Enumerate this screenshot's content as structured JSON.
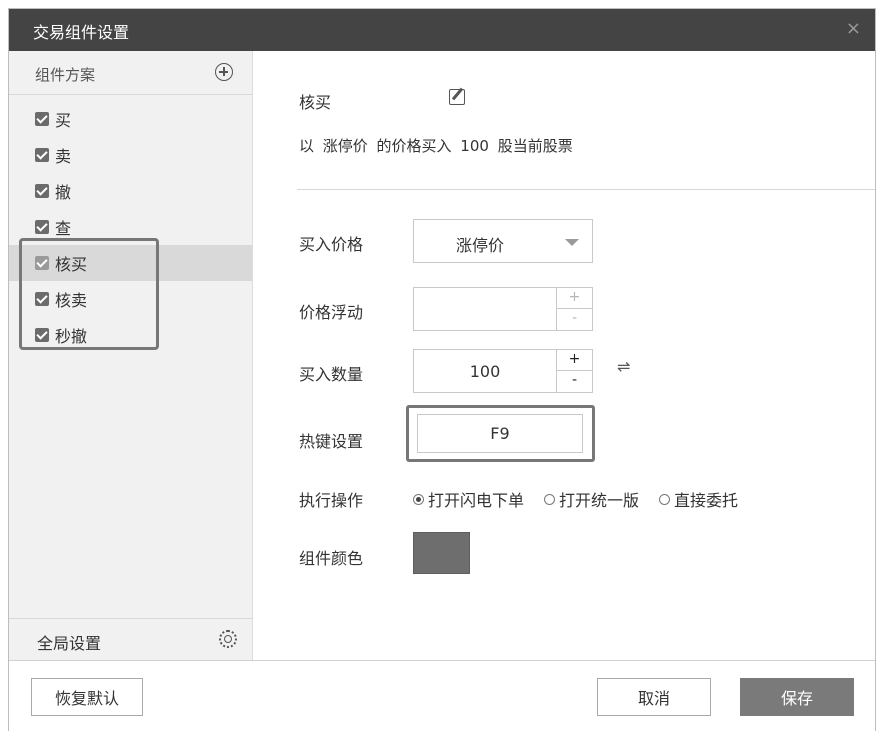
{
  "window": {
    "title": "交易组件设置",
    "close_label": "×"
  },
  "sidebar": {
    "header_label": "组件方案",
    "items": [
      {
        "label": "买",
        "checked": true
      },
      {
        "label": "卖",
        "checked": true
      },
      {
        "label": "撤",
        "checked": true
      },
      {
        "label": "查",
        "checked": true
      },
      {
        "label": "核买",
        "checked": true,
        "selected": true
      },
      {
        "label": "核卖",
        "checked": true
      },
      {
        "label": "秒撤",
        "checked": true
      }
    ],
    "footer_label": "全局设置"
  },
  "main": {
    "component_name": "核买",
    "description": "以 涨停价 的价格买入 100 股当前股票",
    "price_label": "买入价格",
    "price_value": "涨停价",
    "float_label": "价格浮动",
    "float_value": "",
    "qty_label": "买入数量",
    "qty_value": "100",
    "hotkey_label": "热键设置",
    "hotkey_value": "F9",
    "action_label": "执行操作",
    "actions": [
      {
        "label": "打开闪电下单",
        "selected": true
      },
      {
        "label": "打开统一版",
        "selected": false
      },
      {
        "label": "直接委托",
        "selected": false
      }
    ],
    "color_label": "组件颜色",
    "color_value": "#6e6e6e",
    "swap_label": "⇌",
    "plus_label": "+",
    "minus_label": "-"
  },
  "footer": {
    "default_label": "恢复默认",
    "cancel_label": "取消",
    "save_label": "保存"
  }
}
